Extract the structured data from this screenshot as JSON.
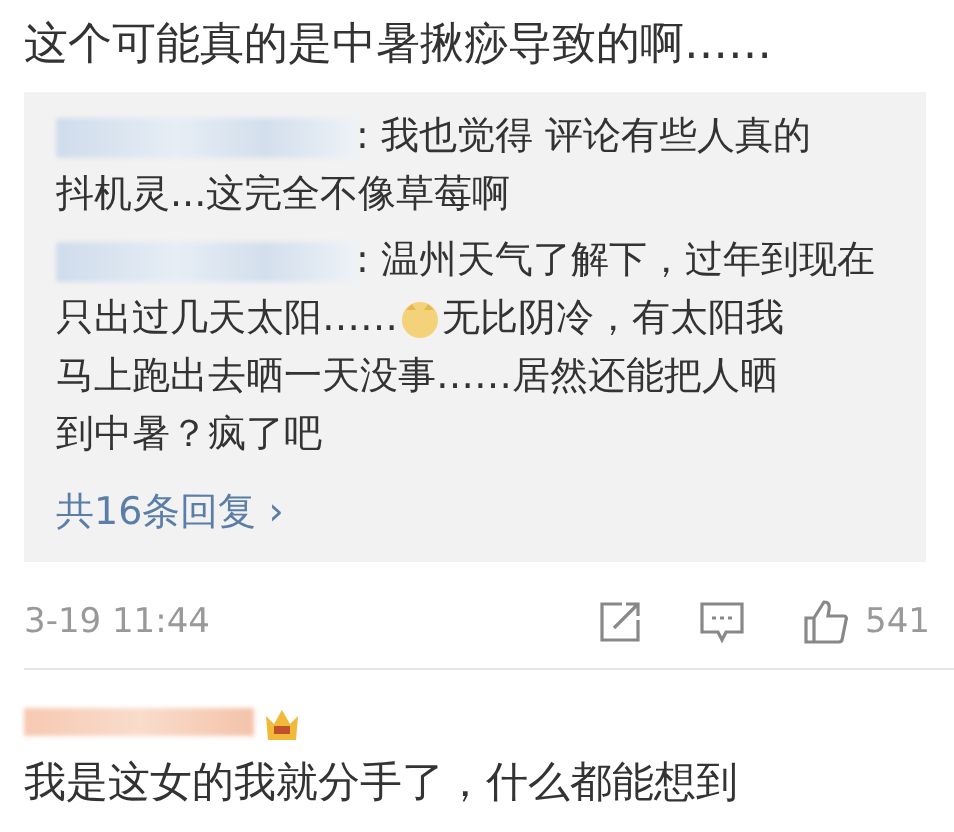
{
  "comment": {
    "text": "这个可能真的是中暑揪痧导致的啊……"
  },
  "replies": [
    {
      "lines": [
        [
          {
            "kind": "name"
          },
          {
            "kind": "text",
            "text": ": 我也觉得 评论有些人真的"
          }
        ],
        [
          {
            "kind": "text",
            "text": "抖机灵...这完全不像草莓啊"
          }
        ]
      ]
    },
    {
      "lines": [
        [
          {
            "kind": "name"
          },
          {
            "kind": "text",
            "text": ": 温州天气了解下，过年到现在"
          }
        ],
        [
          {
            "kind": "text",
            "text": "只出过几天太阳……"
          },
          {
            "kind": "emoji"
          },
          {
            "kind": "text",
            "text": "无比阴冷，有太阳我"
          }
        ],
        [
          {
            "kind": "text",
            "text": "马上跑出去晒一天没事……居然还能把人晒"
          }
        ],
        [
          {
            "kind": "text",
            "text": "到中暑？疯了吧"
          }
        ]
      ]
    }
  ],
  "more_replies": {
    "label": "共16条回复",
    "arrow": "›"
  },
  "footer": {
    "time": "3-19 11:44",
    "likes": "541"
  },
  "next_comment": {
    "text": "我是这女的我就分手了，什么都能想到"
  }
}
